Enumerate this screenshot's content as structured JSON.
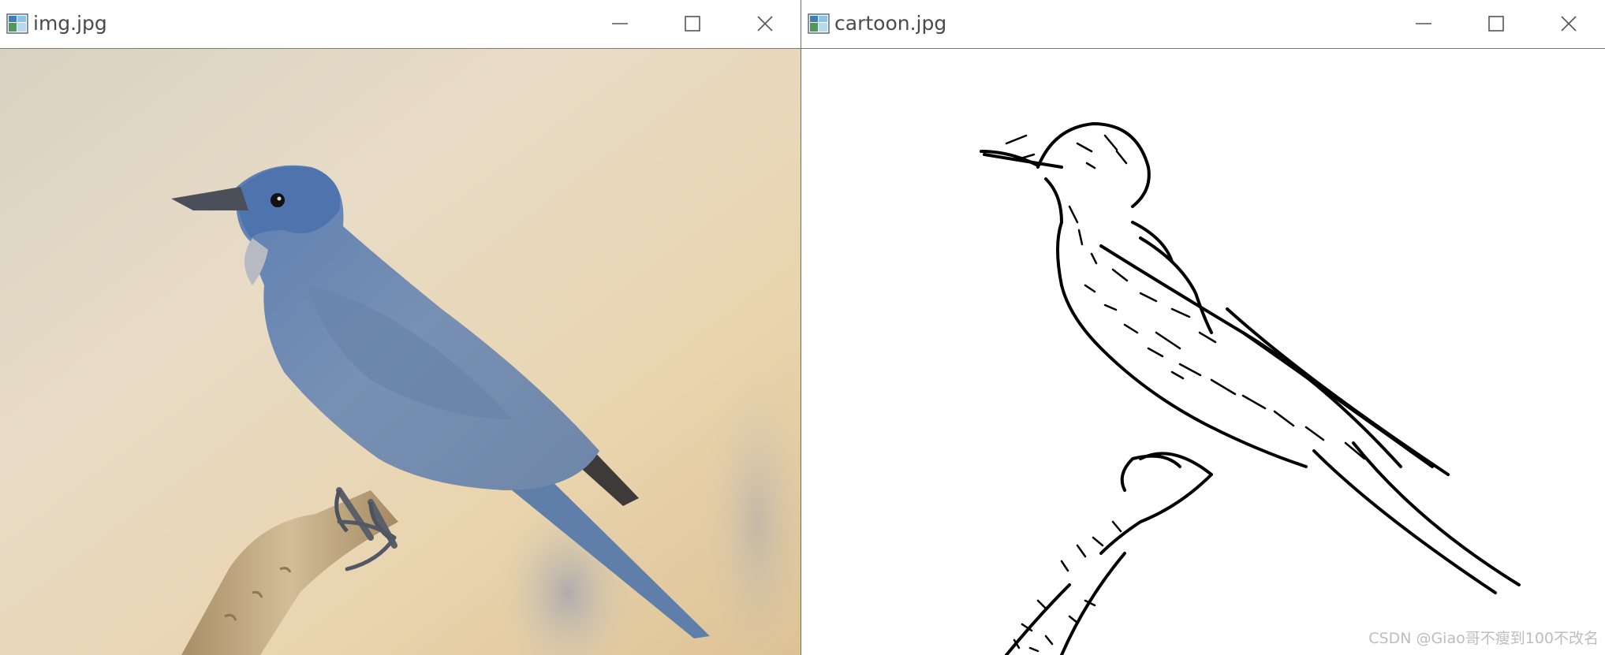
{
  "windows": [
    {
      "title": "img.jpg",
      "content": "blue-bird-photo"
    },
    {
      "title": "cartoon.jpg",
      "content": "bird-line-drawing"
    }
  ],
  "controls": {
    "minimize": "minimize-icon",
    "maximize": "maximize-icon",
    "close": "close-icon"
  },
  "watermark": "CSDN @Giao哥不瘦到100不改名",
  "colors": {
    "bird_blue": "#6f8aad",
    "background_beige": "#e6d7bd",
    "branch": "#c2aa84",
    "titlebar": "#ffffff",
    "title_text": "#4a4a4a"
  }
}
